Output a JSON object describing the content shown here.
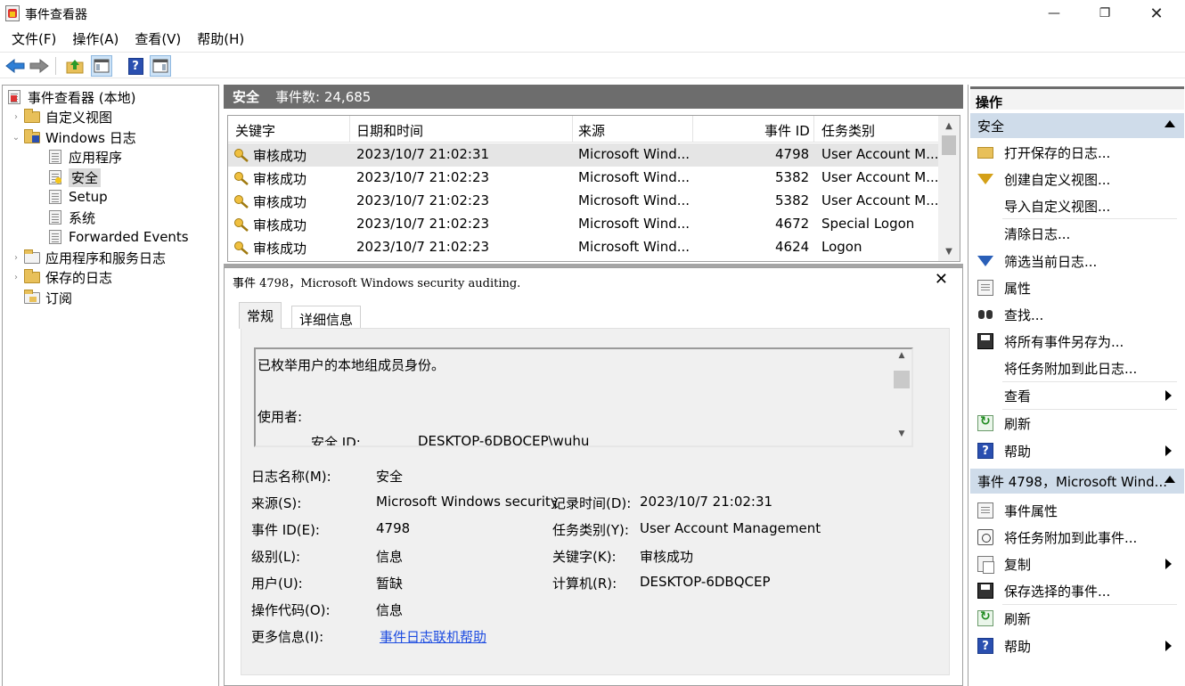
{
  "window": {
    "title": "事件查看器",
    "minimize_glyph": "—",
    "restore_glyph": "❐",
    "close_glyph": "✕"
  },
  "menu": [
    "文件(F)",
    "操作(A)",
    "查看(V)",
    "帮助(H)"
  ],
  "tree": {
    "root": "事件查看器 (本地)",
    "custom_views": "自定义视图",
    "windows_logs": "Windows 日志",
    "application": "应用程序",
    "security": "安全",
    "setup": "Setup",
    "system": "系统",
    "forwarded": "Forwarded Events",
    "app_service_logs": "应用程序和服务日志",
    "saved_logs": "保存的日志",
    "subscriptions": "订阅"
  },
  "middle": {
    "header_title": "安全",
    "header_count": "事件数: 24,685",
    "columns": {
      "keyword": "关键字",
      "datetime": "日期和时间",
      "source": "来源",
      "event_id": "事件 ID",
      "category": "任务类别"
    },
    "rows": [
      {
        "keyword": "审核成功",
        "datetime": "2023/10/7 21:02:31",
        "source": "Microsoft Wind...",
        "event_id": "4798",
        "category": "User Account M..."
      },
      {
        "keyword": "审核成功",
        "datetime": "2023/10/7 21:02:23",
        "source": "Microsoft Wind...",
        "event_id": "5382",
        "category": "User Account M..."
      },
      {
        "keyword": "审核成功",
        "datetime": "2023/10/7 21:02:23",
        "source": "Microsoft Wind...",
        "event_id": "5382",
        "category": "User Account M..."
      },
      {
        "keyword": "审核成功",
        "datetime": "2023/10/7 21:02:23",
        "source": "Microsoft Wind...",
        "event_id": "4672",
        "category": "Special Logon"
      },
      {
        "keyword": "审核成功",
        "datetime": "2023/10/7 21:02:23",
        "source": "Microsoft Wind...",
        "event_id": "4624",
        "category": "Logon"
      }
    ]
  },
  "detail": {
    "title": "事件 4798，Microsoft Windows security auditing.",
    "close": "✕",
    "tab_general": "常规",
    "tab_details": "详细信息",
    "description": {
      "line1": "已枚举用户的本地组成员身份。",
      "line2": "使用者:",
      "sid_label": "安全 ID:",
      "sid_value": "DESKTOP-6DBQCEP\\wuhu"
    },
    "fields": {
      "log_name_label": "日志名称(M):",
      "log_name": "安全",
      "source_label": "来源(S):",
      "source": "Microsoft Windows security",
      "logged_label": "记录时间(D):",
      "logged": "2023/10/7 21:02:31",
      "event_id_label": "事件 ID(E):",
      "event_id": "4798",
      "task_label": "任务类别(Y):",
      "task": "User Account Management",
      "level_label": "级别(L):",
      "level": "信息",
      "keywords_label": "关键字(K):",
      "keywords": "审核成功",
      "user_label": "用户(U):",
      "user": "暂缺",
      "computer_label": "计算机(R):",
      "computer": "DESKTOP-6DBQCEP",
      "opcode_label": "操作代码(O):",
      "opcode": "信息",
      "more_info_label": "更多信息(I):",
      "more_info_link": "事件日志联机帮助"
    }
  },
  "actions": {
    "header": "操作",
    "section1": "安全",
    "items1": [
      "打开保存的日志...",
      "创建自定义视图...",
      "导入自定义视图...",
      "清除日志...",
      "筛选当前日志...",
      "属性",
      "查找...",
      "将所有事件另存为...",
      "将任务附加到此日志...",
      "查看",
      "刷新",
      "帮助"
    ],
    "section2": "事件 4798，Microsoft Wind...",
    "items2": [
      "事件属性",
      "将任务附加到此事件...",
      "复制",
      "保存选择的事件...",
      "刷新",
      "帮助"
    ]
  },
  "colors": {
    "header_gray": "#6d6d6d",
    "section_blue": "#cfdcea",
    "link_blue": "#1c4be0",
    "selection_gray": "#e5e5e5"
  }
}
